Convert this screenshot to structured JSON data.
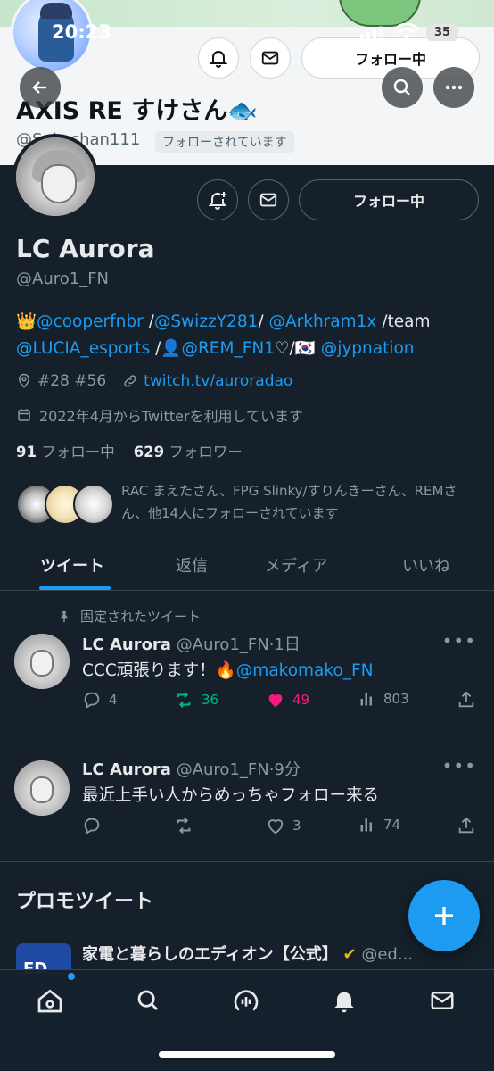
{
  "status_bar": {
    "time": "20:23",
    "battery": "35"
  },
  "ghost_profile": {
    "name": "AXIS RE すけさん🐟",
    "handle": "@Sukeshan111",
    "follows_you": "フォローされています",
    "follow_label": "フォロー中"
  },
  "profile": {
    "name": "LC Aurora",
    "handle": "@Auro1_FN",
    "follow_label": "フォロー中",
    "bio": {
      "crown": "👑",
      "m1": "@cooperfnbr",
      "sep1": " /",
      "m2": "@SwizzY281",
      "sep2": "/ ",
      "m3": "@Arkhram1x",
      "team": " /team",
      "m4": "@LUCIA_esports",
      "sep3": " /👤",
      "m5": "@REM_FN1",
      "heart": "♡/🇰🇷 ",
      "m6": "@jypnation"
    },
    "location": "#28 #56",
    "link": "twitch.tv/auroradao",
    "joined": "2022年4月からTwitterを利用しています",
    "following_count": "91",
    "following_label": "フォロー中",
    "followers_count": "629",
    "followers_label": "フォロワー",
    "followed_by": "RAC まえたさん、FPG Slinky/すりんきーさん、REMさん、他14人にフォローされています"
  },
  "tabs": [
    {
      "label": "ツイート"
    },
    {
      "label": "返信"
    },
    {
      "label": "メディア"
    },
    {
      "label": "いいね"
    }
  ],
  "tweets": [
    {
      "pinned_label": "固定されたツイート",
      "name": "LC Aurora",
      "meta": "@Auro1_FN·1日",
      "text": "CCC頑張ります！🔥",
      "mention": "@makomako_FN",
      "replies": "4",
      "retweets": "36",
      "likes": "49",
      "views": "803"
    },
    {
      "name": "LC Aurora",
      "meta": "@Auro1_FN·9分",
      "text": "最近上手い人からめっちゃフォロー来る",
      "replies": "",
      "retweets": "",
      "likes": "3",
      "views": "74"
    }
  ],
  "promo": {
    "heading": "プロモツイート",
    "avatar_text": "ED",
    "name": "家電と暮らしのエディオン【公式】",
    "handle": "@ed..."
  },
  "colors": {
    "background": "#15202b",
    "accent": "#1d9bf0",
    "retweet": "#00ba7c",
    "like": "#f91880",
    "muted": "#8b98a5"
  },
  "icons": [
    "back-arrow-icon",
    "search-icon",
    "more-icon",
    "bell-plus-icon",
    "mail-icon",
    "location-icon",
    "link-icon",
    "calendar-icon",
    "pin-icon",
    "reply-icon",
    "retweet-icon",
    "heart-icon",
    "views-icon",
    "share-icon",
    "plus-icon",
    "home-icon",
    "spaces-icon",
    "notifications-icon",
    "messages-icon"
  ]
}
